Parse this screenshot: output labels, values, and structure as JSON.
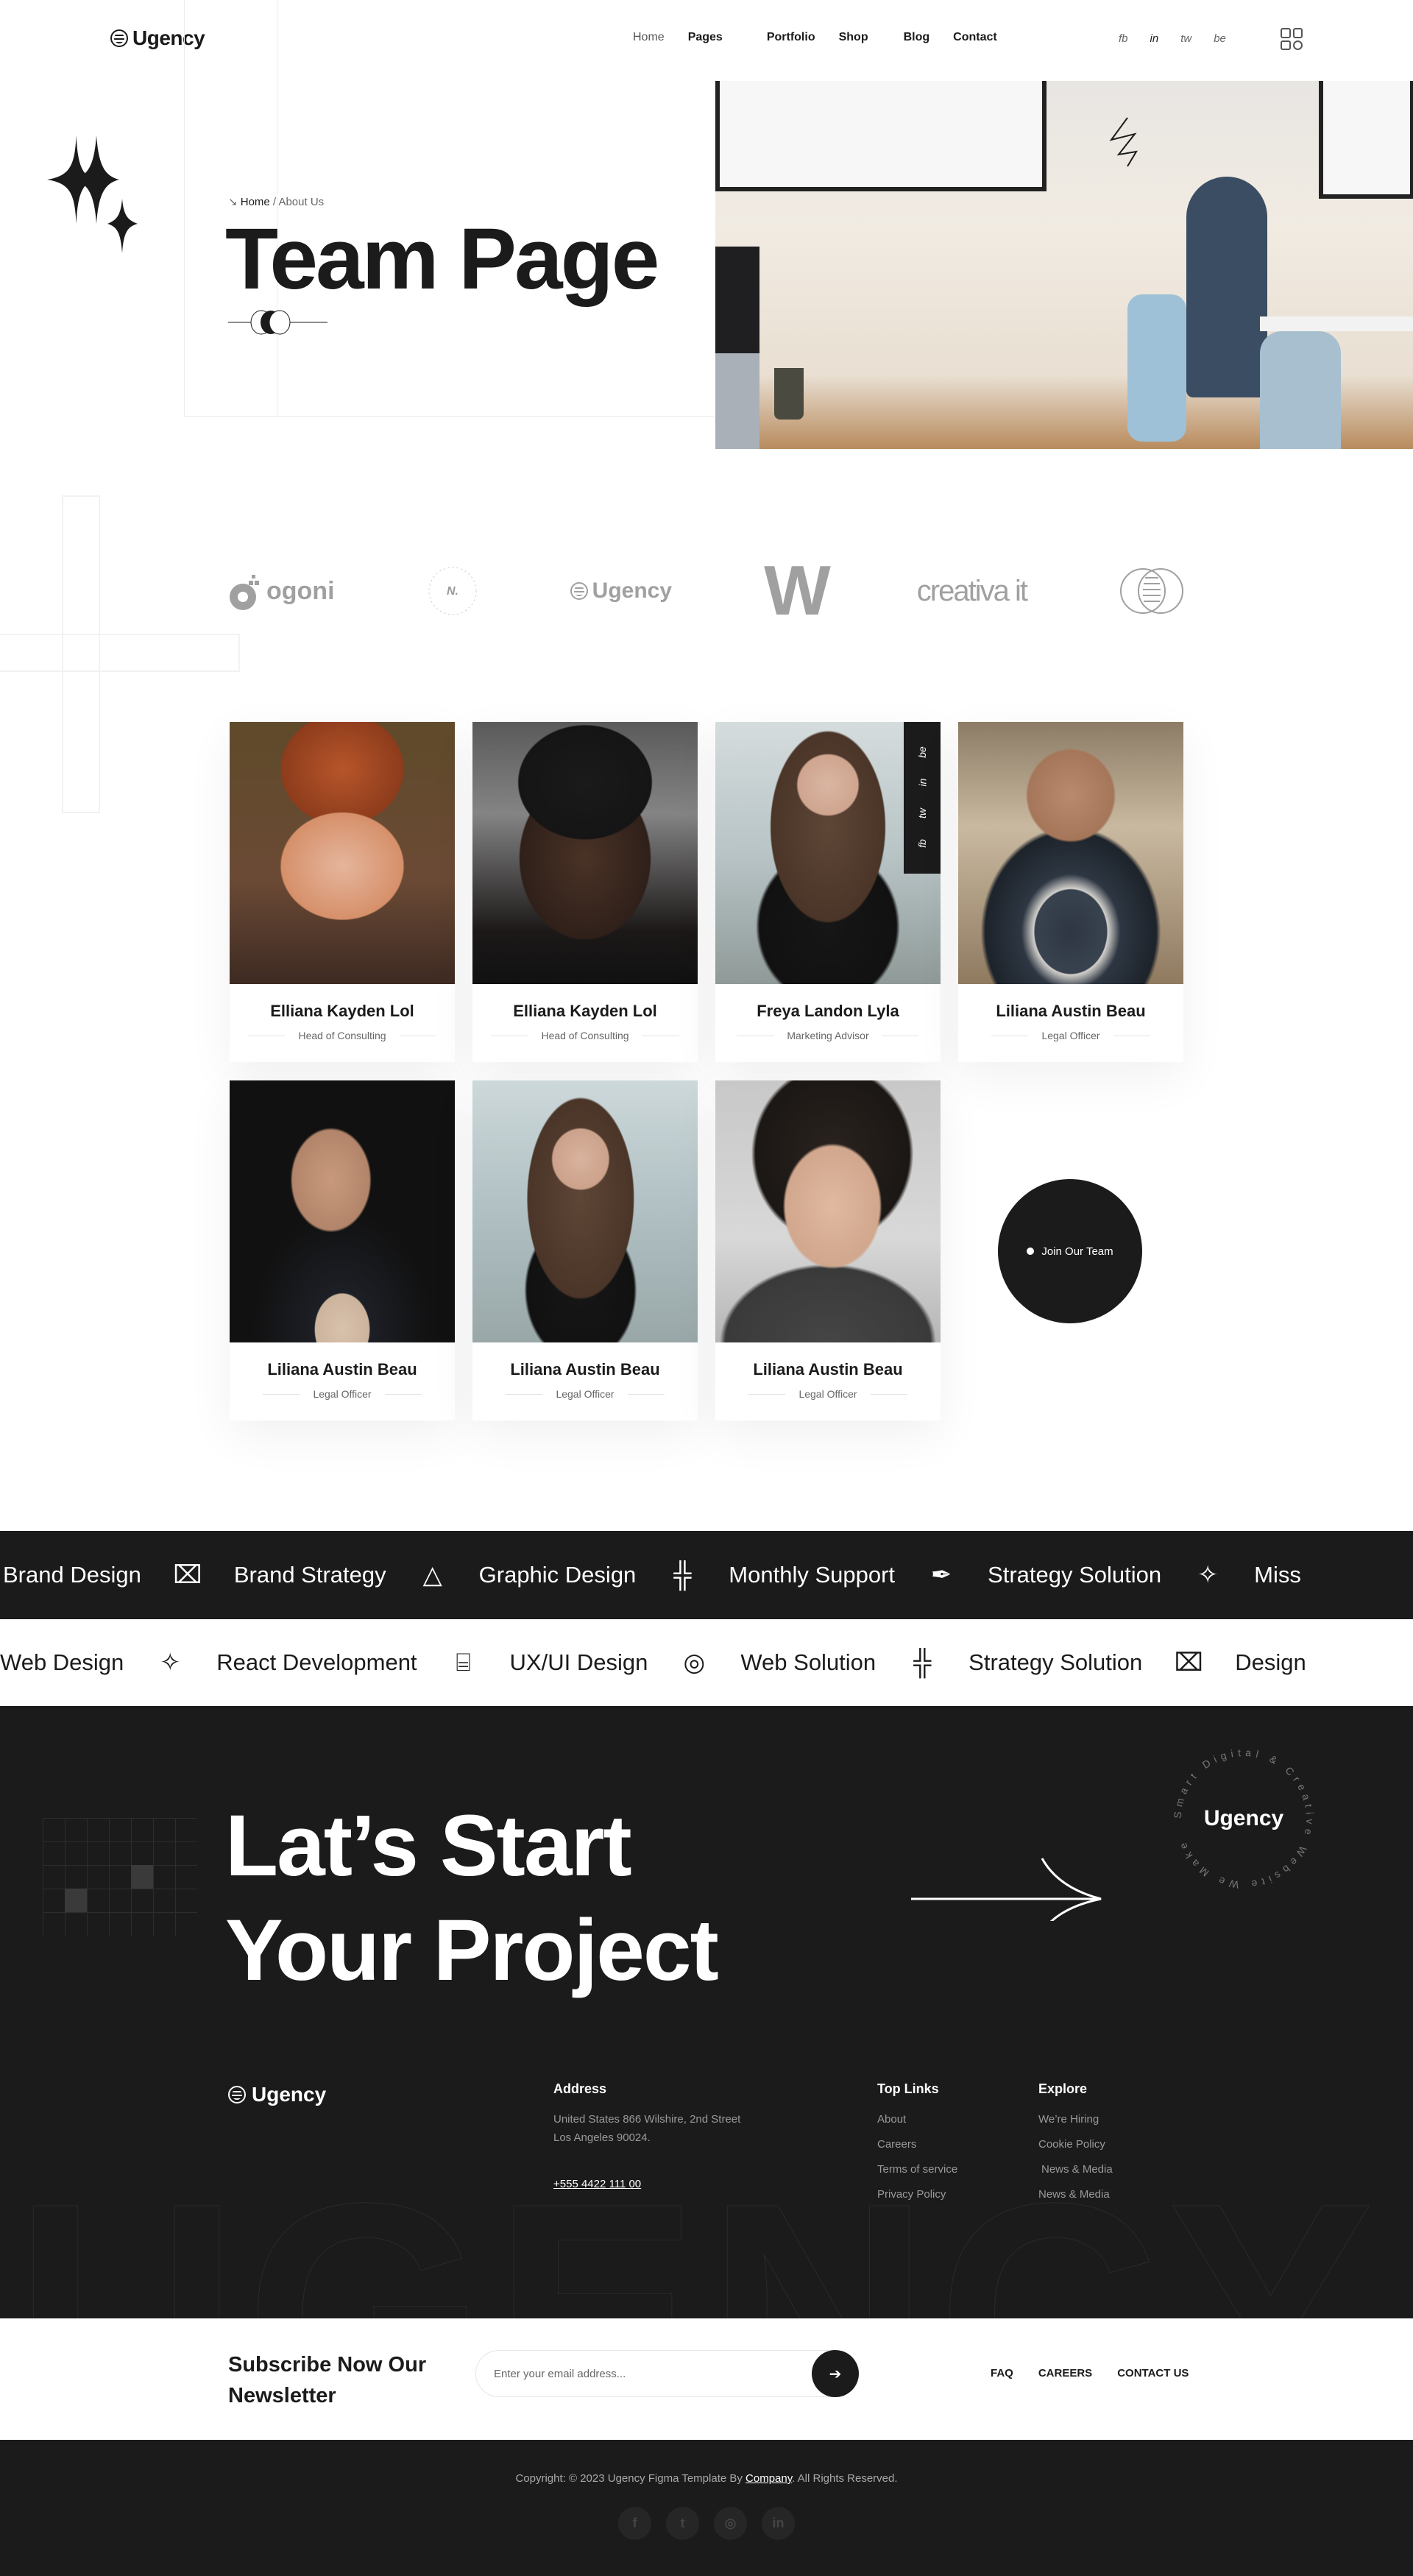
{
  "header": {
    "brand": "Ugency",
    "nav": [
      {
        "label": "Home",
        "active": true
      },
      {
        "label": "Pages"
      },
      {
        "label": "Portfolio"
      },
      {
        "label": "Shop"
      },
      {
        "label": "Blog"
      },
      {
        "label": "Contact"
      }
    ],
    "social": [
      "fb",
      "in",
      "tw",
      "be"
    ]
  },
  "hero": {
    "breadcrumb_home": "Home",
    "breadcrumb_sep": " / ",
    "breadcrumb_current": "About Us",
    "title": "Team Page"
  },
  "partners": [
    "ogoni",
    "creative agency",
    "Ugency",
    "W",
    "creativa it",
    "overlap-circles"
  ],
  "team": [
    {
      "name": "Elliana Kayden Lol",
      "role": "Head of Consulting"
    },
    {
      "name": "Elliana Kayden Lol",
      "role": "Head of Consulting"
    },
    {
      "name": "Freya Landon Lyla",
      "role": "Marketing Advisor",
      "social": [
        "fb",
        "tw",
        "in",
        "be"
      ]
    },
    {
      "name": "Liliana Austin Beau",
      "role": "Legal Officer"
    },
    {
      "name": "Liliana Austin Beau",
      "role": "Legal Officer"
    },
    {
      "name": "Liliana Austin Beau",
      "role": "Legal Officer"
    },
    {
      "name": "Liliana Austin Beau",
      "role": "Legal Officer"
    }
  ],
  "join_label": "Join Our Team",
  "marquee_dark": [
    {
      "label": "Brand Design",
      "icon": "easel-icon"
    },
    {
      "label": "Brand Strategy",
      "icon": "triangles-icon"
    },
    {
      "label": "Graphic Design",
      "icon": "cube-net-icon"
    },
    {
      "label": "Monthly Support",
      "icon": "pen-tool-icon"
    },
    {
      "label": "Strategy Solution",
      "icon": "sparkle-icon"
    },
    {
      "label": "Miss",
      "icon": ""
    }
  ],
  "marquee_light": [
    {
      "label": "Web Design",
      "icon": "sparkle-icon"
    },
    {
      "label": "React Development",
      "icon": "cylinder-icon"
    },
    {
      "label": "UX/UI Design",
      "icon": "globe-lines-icon"
    },
    {
      "label": "Web Solution",
      "icon": "cube-net-icon"
    },
    {
      "label": "Strategy Solution",
      "icon": "easel-icon"
    },
    {
      "label": "Design",
      "icon": ""
    }
  ],
  "cta": {
    "line1": "Lat’s Start",
    "line2": "Your Project",
    "badge_center": "Ugency",
    "badge_ring": "Smart Digital & Creative Website We Make "
  },
  "footer": {
    "brand": "Ugency",
    "address_title": "Address",
    "address_line1": "United States 866 Wilshire, 2nd Street",
    "address_line2": "Los Angeles 90024.",
    "phone": "+555 4422 111 00",
    "top_links_title": "Top Links",
    "top_links": [
      "About",
      "Careers",
      "Terms of service",
      "Privacy Policy"
    ],
    "explore_title": "Explore",
    "explore": [
      "We’re Hiring",
      "Cookie Policy",
      "News & Media",
      "News & Media"
    ],
    "bigword": "UGENCY"
  },
  "newsletter": {
    "title_line1": "Subscribe Now Our",
    "title_line2": "Newsletter",
    "placeholder": "Enter your email address...",
    "links": [
      "FAQ",
      "CAREERS",
      "CONTACT US"
    ]
  },
  "bottom": {
    "copy_before": "Copyright: © 2023 Ugency Figma Template By ",
    "copy_link": "Company",
    "copy_after": ". All Rights Reserved.",
    "socials": [
      "facebook",
      "twitter",
      "instagram",
      "linkedin"
    ]
  }
}
